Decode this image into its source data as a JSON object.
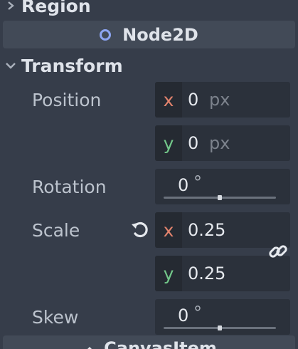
{
  "sections": {
    "region": {
      "label": "Region",
      "expanded": false
    },
    "node2d": {
      "label": "Node2D",
      "icon": "node2d-circle-icon"
    },
    "transform": {
      "label": "Transform",
      "expanded": true
    },
    "canvas_item": {
      "label": "CanvasItem",
      "icon": "pencil-icon"
    }
  },
  "properties": {
    "position": {
      "label": "Position",
      "x": {
        "axis": "x",
        "value": "0",
        "unit": "px"
      },
      "y": {
        "axis": "y",
        "value": "0",
        "unit": "px"
      }
    },
    "rotation": {
      "label": "Rotation",
      "value": "0",
      "unit": "°",
      "slider_fraction": 0.5
    },
    "scale": {
      "label": "Scale",
      "x": {
        "axis": "x",
        "value": "0.25"
      },
      "y": {
        "axis": "y",
        "value": "0.25"
      },
      "revert_icon": "revert-icon",
      "link_icon": "link-icon"
    },
    "skew": {
      "label": "Skew",
      "value": "0",
      "unit": "°",
      "slider_fraction": 0.5
    }
  },
  "colors": {
    "background": "#363d4a",
    "field": "#2b313b",
    "axis_x": "#e2836d",
    "axis_y": "#73c88a",
    "node_icon": "#8da5f3"
  }
}
